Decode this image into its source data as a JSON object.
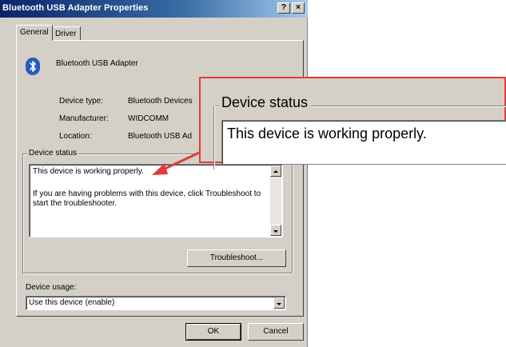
{
  "window": {
    "title": "Bluetooth USB Adapter Properties",
    "help_btn": "?",
    "close_btn": "×"
  },
  "tabs": [
    {
      "label": "General",
      "active": true
    },
    {
      "label": "Driver",
      "active": false
    }
  ],
  "device": {
    "name": "Bluetooth USB Adapter",
    "icon": "bluetooth-icon",
    "rows": [
      {
        "label": "Device type:",
        "value": "Bluetooth Devices"
      },
      {
        "label": "Manufacturer:",
        "value": "WIDCOMM"
      },
      {
        "label": "Location:",
        "value": "Bluetooth USB Ad"
      }
    ]
  },
  "status": {
    "group_label": "Device status",
    "line1": "This device is working properly.",
    "line2": "If you are having problems with this device, click Troubleshoot to start the troubleshooter.",
    "troubleshoot_btn": "Troubleshoot..."
  },
  "usage": {
    "label": "Device usage:",
    "selected": "Use this device (enable)"
  },
  "footer": {
    "ok": "OK",
    "cancel": "Cancel"
  },
  "zoom": {
    "group_label": "Device status",
    "text": "This device is working properly."
  },
  "colors": {
    "accent_red": "#e23a3a",
    "title_blue": "#0a246a",
    "face": "#d4d0c8"
  }
}
